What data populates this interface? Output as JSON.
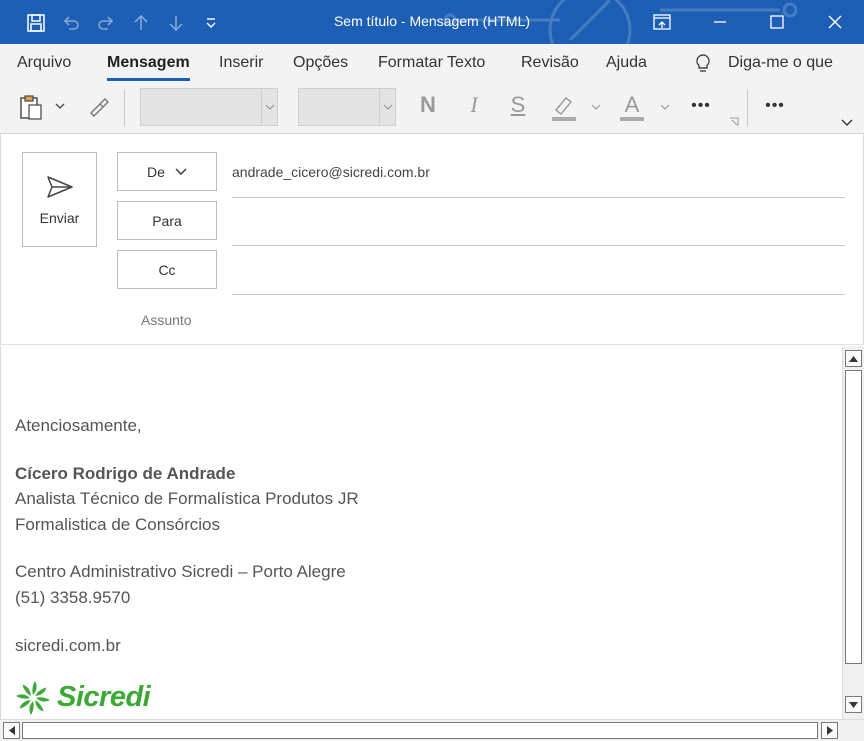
{
  "window": {
    "title": "Sem título  -  Mensagem (HTML)"
  },
  "ribbon": {
    "tabs": [
      {
        "label": "Arquivo"
      },
      {
        "label": "Mensagem",
        "active": true
      },
      {
        "label": "Inserir"
      },
      {
        "label": "Opções"
      },
      {
        "label": "Formatar Texto"
      },
      {
        "label": "Revisão"
      },
      {
        "label": "Ajuda"
      }
    ],
    "tell_me": "Diga-me o que",
    "font_name": "",
    "font_size": "",
    "format_glyphs": {
      "bold": "N",
      "italic": "I",
      "underline": "S",
      "font_color": "A"
    },
    "more": "•••"
  },
  "compose": {
    "send_label": "Enviar",
    "from_label": "De",
    "from_value": "andrade_cicero@sicredi.com.br",
    "to_label": "Para",
    "to_value": "",
    "cc_label": "Cc",
    "cc_value": "",
    "subject_label": "Assunto"
  },
  "signature": {
    "greeting": "Atenciosamente,",
    "name": "Cícero Rodrigo de Andrade",
    "role": "Analista Técnico de Formalística Produtos JR",
    "department": "Formalistica de Consórcios",
    "location": "Centro Administrativo Sicredi – Porto Alegre",
    "phone": "(51) 3358.9570",
    "website": "sicredi.com.br",
    "logo_text": "Sicredi"
  },
  "colors": {
    "accent": "#1d5fb4",
    "brand_green": "#3aa935"
  }
}
